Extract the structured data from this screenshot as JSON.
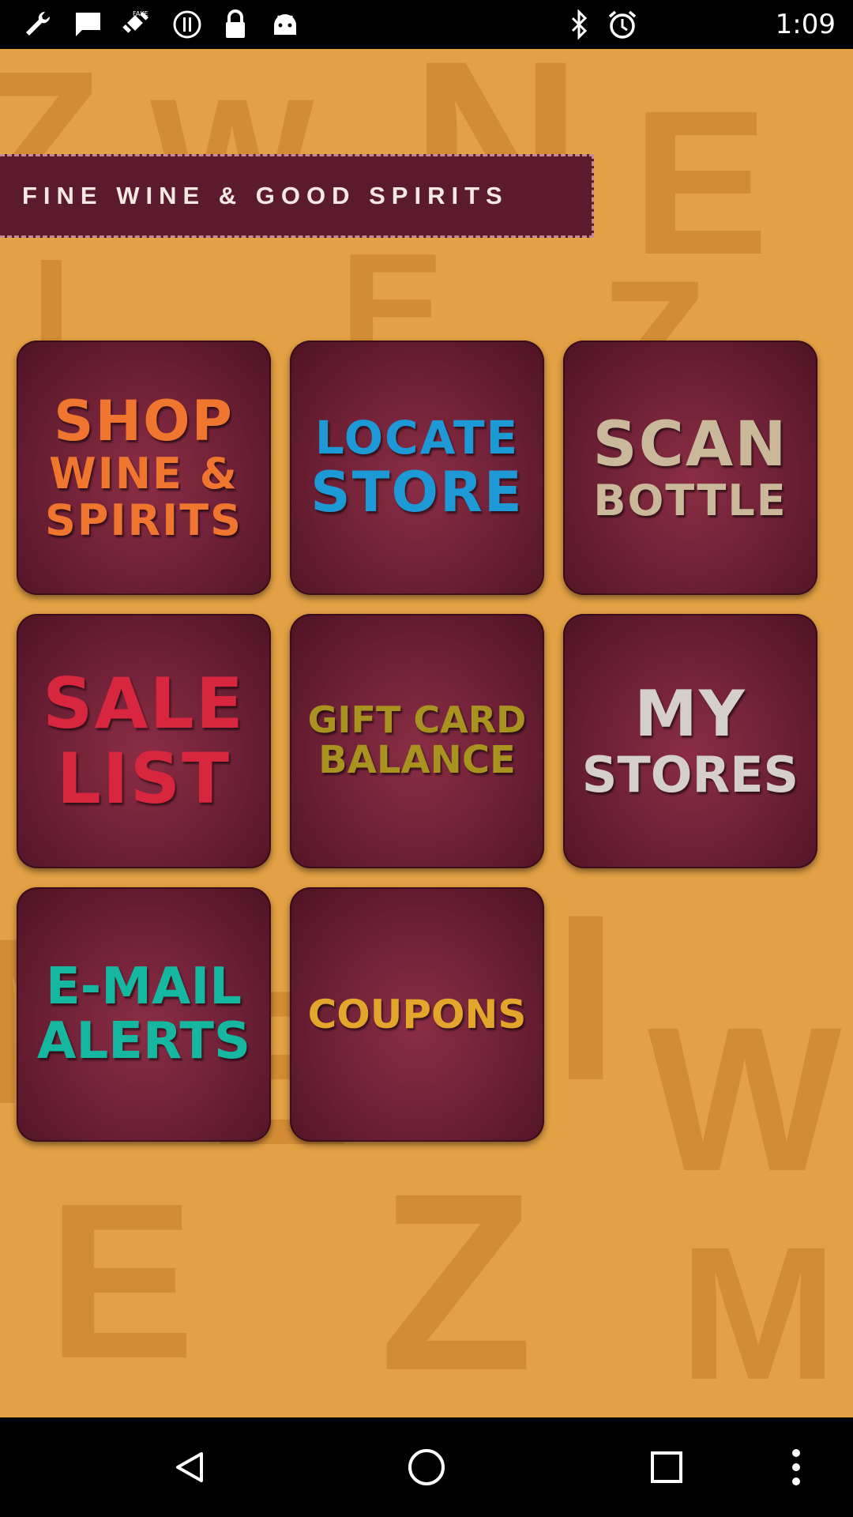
{
  "status_bar": {
    "time": "1:09",
    "left_icons": [
      "wrench-icon",
      "message-icon",
      "fake-gps-icon",
      "alert-icon",
      "lock-icon",
      "android-icon"
    ],
    "right_icons": [
      "bluetooth-icon",
      "alarm-icon"
    ]
  },
  "banner": {
    "text": "FINE WINE & GOOD SPIRITS"
  },
  "tiles": [
    {
      "name": "shop-wine-spirits-tile",
      "lines": [
        "SHOP",
        "WINE &",
        "SPIRITS"
      ],
      "color": "#f0752e"
    },
    {
      "name": "locate-store-tile",
      "lines": [
        "LOCATE",
        "STORE"
      ],
      "color": "#1d9ad6"
    },
    {
      "name": "scan-bottle-tile",
      "lines": [
        "SCAN",
        "BOTTLE"
      ],
      "color": "#c9b99a"
    },
    {
      "name": "sale-list-tile",
      "lines": [
        "SALE",
        "LIST"
      ],
      "color": "#d9263f"
    },
    {
      "name": "gift-card-balance-tile",
      "lines": [
        "GIFT CARD",
        "BALANCE"
      ],
      "color": "#a89220"
    },
    {
      "name": "my-stores-tile",
      "lines": [
        "MY",
        "STORES"
      ],
      "color": "#d4cfc8"
    },
    {
      "name": "email-alerts-tile",
      "lines": [
        "E-MAIL",
        "ALERTS"
      ],
      "color": "#16b7a0"
    },
    {
      "name": "coupons-tile",
      "lines": [
        "COUPONS"
      ],
      "color": "#e3a52c"
    }
  ],
  "nav_bar": {
    "buttons": [
      "back-icon",
      "home-icon",
      "recents-icon",
      "menu-icon"
    ]
  }
}
